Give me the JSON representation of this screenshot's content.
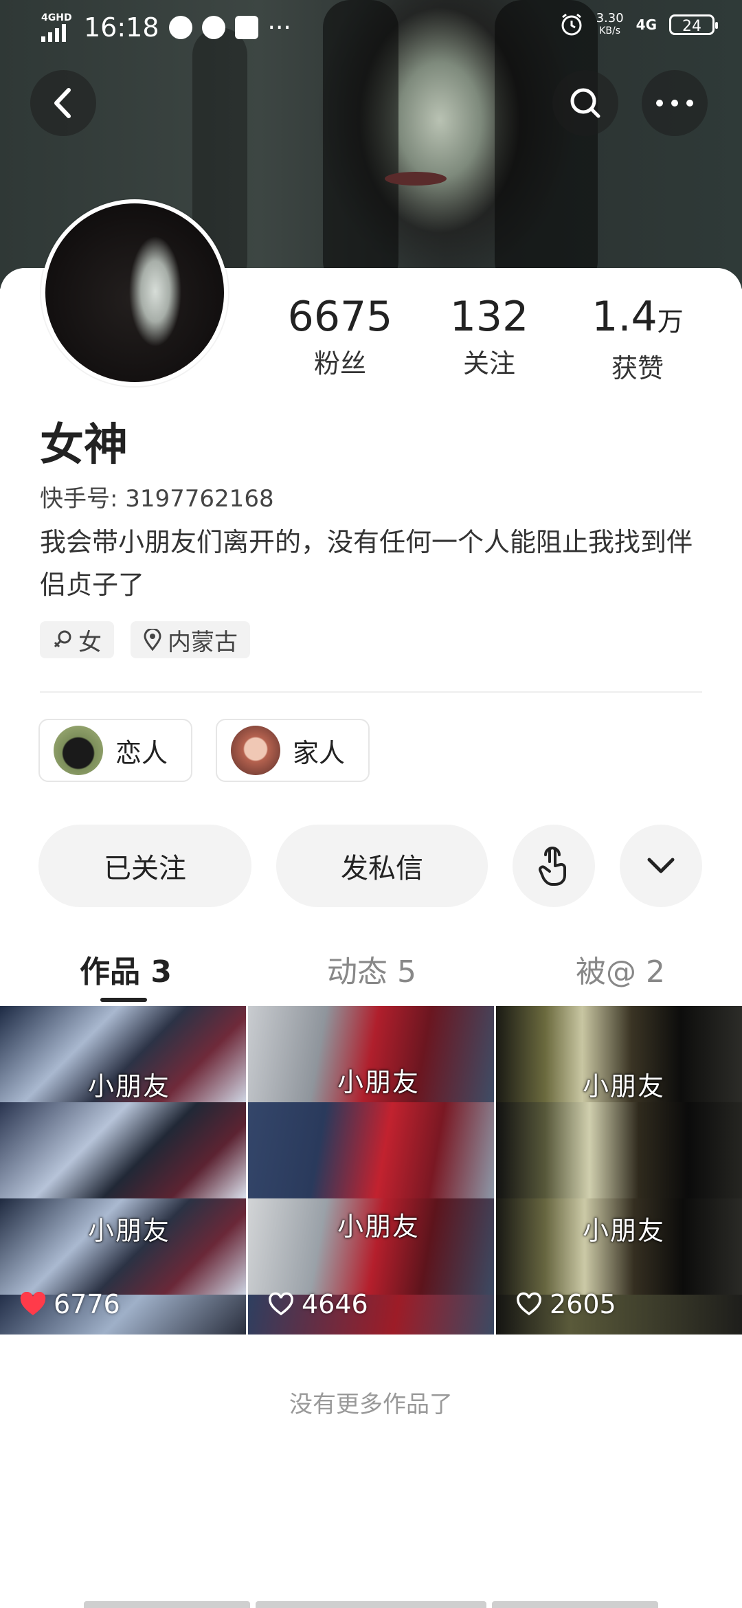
{
  "status_bar": {
    "network_label": "4GHD",
    "time": "16:18",
    "more": "···",
    "speed_value": "3.30",
    "speed_unit": "KB/s",
    "signal_label": "4G",
    "battery": "24"
  },
  "profile": {
    "name": "女神",
    "kuaishou_id": "快手号: 3197762168",
    "bio": "我会带小朋友们离开的，没有任何一个人能阻止我找到伴侣贞子了",
    "tags": [
      {
        "icon": "female-icon",
        "label": "女"
      },
      {
        "icon": "location-pin-icon",
        "label": "内蒙古"
      }
    ]
  },
  "stats": [
    {
      "value": "6675",
      "unit": "",
      "label": "粉丝"
    },
    {
      "value": "132",
      "unit": "",
      "label": "关注"
    },
    {
      "value": "1.4",
      "unit": "万",
      "label": "获赞"
    }
  ],
  "relations": [
    {
      "label": "恋人"
    },
    {
      "label": "家人"
    }
  ],
  "actions": {
    "follow": "已关注",
    "message": "发私信"
  },
  "tabs": [
    {
      "label": "作品 3",
      "active": true
    },
    {
      "label": "动态 5",
      "active": false
    },
    {
      "label": "被@ 2",
      "active": false
    }
  ],
  "videos": [
    {
      "subtitle": "小朋友",
      "likes": "6776",
      "liked": true
    },
    {
      "subtitle": "小朋友",
      "likes": "4646",
      "liked": false
    },
    {
      "subtitle": "小朋友",
      "likes": "2605",
      "liked": false
    }
  ],
  "footer": {
    "no_more": "没有更多作品了"
  },
  "colors": {
    "liked_heart": "#ff3b4a",
    "pill_bg": "#f3f3f3",
    "text_primary": "#222222"
  }
}
